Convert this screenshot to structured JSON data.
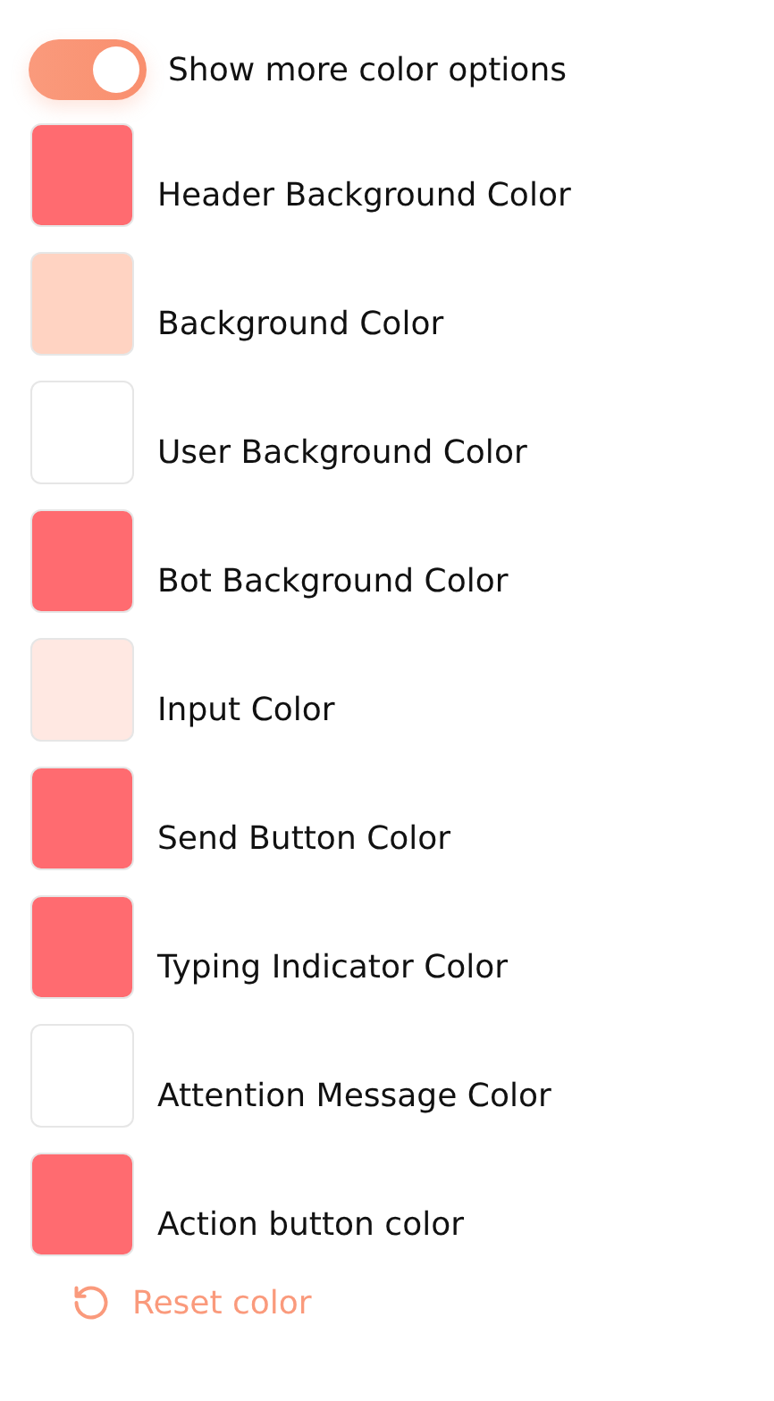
{
  "toggle": {
    "label": "Show more color options",
    "on": true
  },
  "colors": [
    {
      "label": "Header Background Color",
      "color": "#ff6b70"
    },
    {
      "label": "Background Color",
      "color": "#ffd3c2"
    },
    {
      "label": "User Background Color",
      "color": "#ffffff"
    },
    {
      "label": "Bot Background Color",
      "color": "#ff6b70"
    },
    {
      "label": "Input Color",
      "color": "#ffe8e2"
    },
    {
      "label": "Send Button Color",
      "color": "#ff6b70"
    },
    {
      "label": "Typing Indicator Color",
      "color": "#ff6b70"
    },
    {
      "label": "Attention Message Color",
      "color": "#ffffff"
    },
    {
      "label": "Action button color",
      "color": "#ff6b70"
    }
  ],
  "reset": {
    "label": "Reset color"
  }
}
